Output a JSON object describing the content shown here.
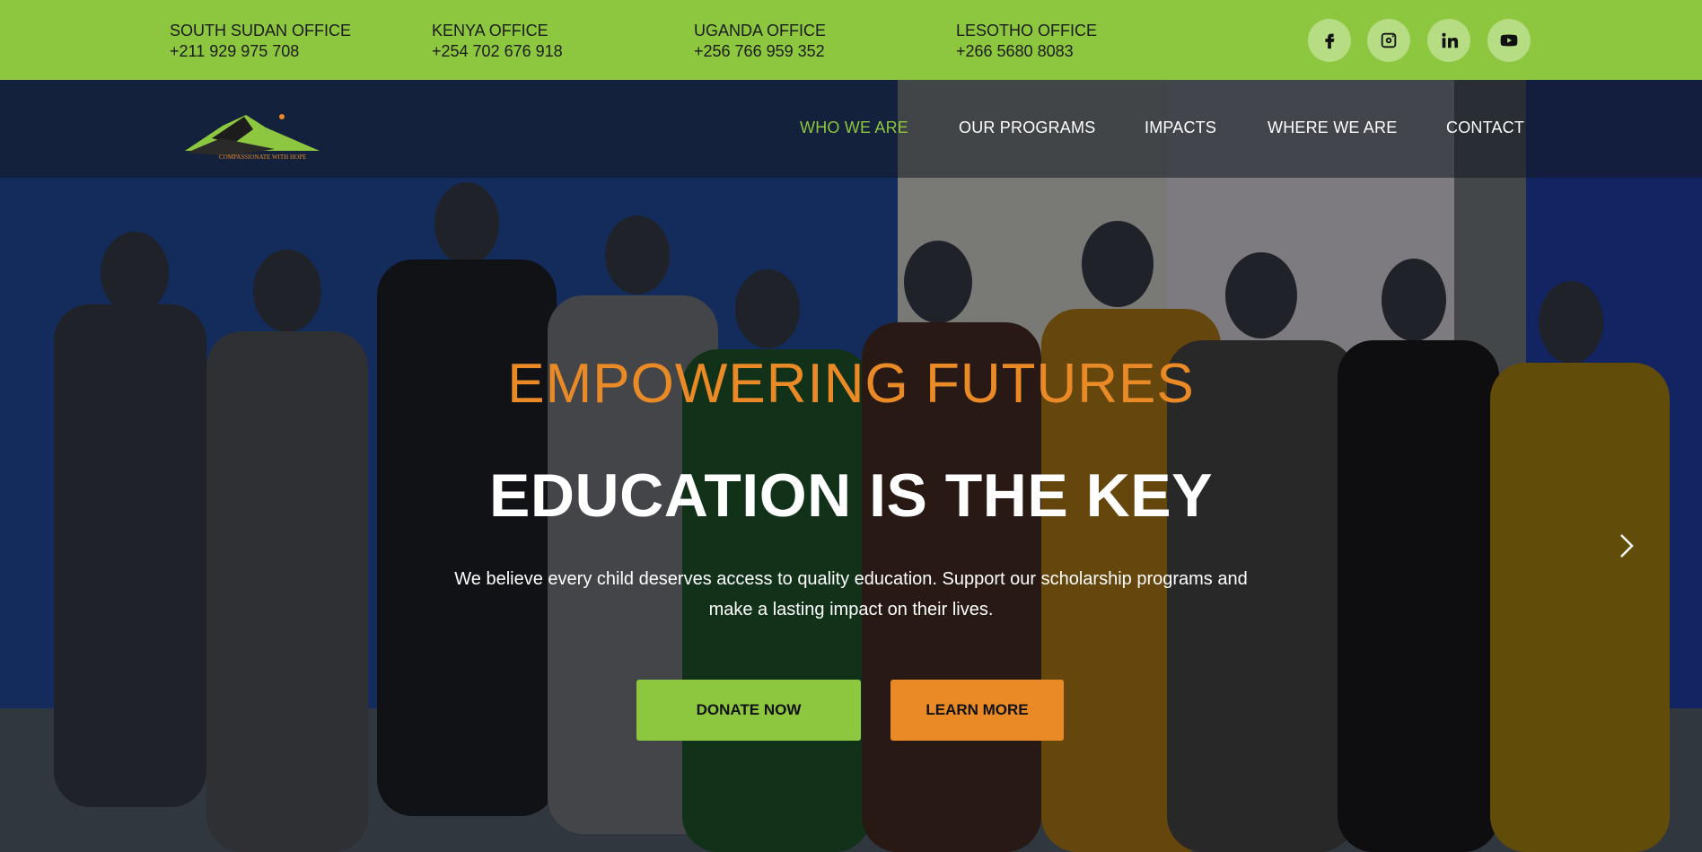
{
  "topbar": {
    "offices": [
      {
        "name": "SOUTH SUDAN OFFICE",
        "phone": "+211 929 975 708"
      },
      {
        "name": "KENYA OFFICE",
        "phone": "+254 702 676 918"
      },
      {
        "name": "UGANDA OFFICE",
        "phone": "+256 766 959 352"
      },
      {
        "name": "LESOTHO OFFICE",
        "phone": "+266 5680 8083"
      }
    ],
    "social": [
      "facebook-icon",
      "instagram-icon",
      "linkedin-icon",
      "youtube-icon"
    ]
  },
  "logo": {
    "tagline": "COMPASSIONATE WITH HOPE"
  },
  "nav": {
    "items": [
      "WHO WE ARE",
      "OUR PROGRAMS",
      "IMPACTS",
      "WHERE WE ARE",
      "CONTACT"
    ],
    "active_index": 0
  },
  "hero": {
    "eyebrow": "EMPOWERING FUTURES",
    "headline": "EDUCATION IS THE KEY",
    "subtext": "We believe every child deserves access to quality education. Support our scholarship programs and make a lasting impact on their lives.",
    "donate_label": "DONATE NOW",
    "learn_label": "LEARN MORE"
  },
  "colors": {
    "brand_green": "#8dc63f",
    "brand_orange": "#e98a27",
    "text_dark": "#1b1b1b"
  }
}
